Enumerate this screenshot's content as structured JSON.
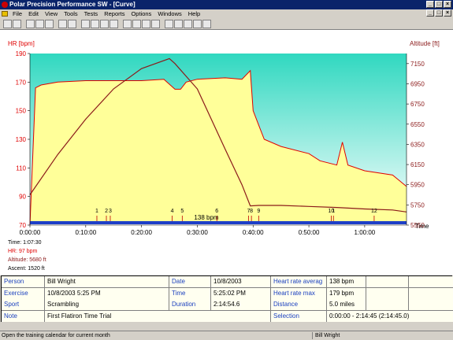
{
  "window": {
    "title": "Polar Precision Performance SW - [Curve]"
  },
  "menu": [
    "File",
    "Edit",
    "View",
    "Tools",
    "Tests",
    "Reports",
    "Options",
    "Windows",
    "Help"
  ],
  "chart": {
    "hr_axis_label": "HR [bpm]",
    "alt_axis_label": "Altitude [ft]",
    "time_label": "Time",
    "hr_ticks": [
      "190",
      "170",
      "150",
      "130",
      "110",
      "90",
      "70"
    ],
    "alt_ticks": [
      "7150",
      "6950",
      "6750",
      "6550",
      "6350",
      "6150",
      "5950",
      "5750",
      "5550"
    ],
    "time_ticks": [
      "0:00:00",
      "0:10:00",
      "0:20:00",
      "0:30:00",
      "0:40:00",
      "0:50:00",
      "1:00:00"
    ],
    "lap_labels": [
      "1",
      "2",
      "3",
      "4",
      "5",
      "6",
      "7",
      "8",
      "9",
      "10",
      "1",
      "12"
    ],
    "avg_label": "138 bpm",
    "cursor": {
      "time": "Time: 1:07:30",
      "hr": "HR: 97 bpm",
      "altitude": "Altitude: 5680 ft",
      "ascent": "Ascent: 1520 ft"
    },
    "colors": {
      "hr": "#e00000",
      "altitude": "#8b1a1a",
      "fill": "#ffff99",
      "bg_top": "#30d8c0",
      "bg_bottom": "#ffffff",
      "band": "#1e3fc8"
    }
  },
  "chart_data": {
    "type": "line",
    "x_unit": "h:mm:ss",
    "xlim": [
      "0:00:00",
      "1:07:30"
    ],
    "ylim_hr": [
      70,
      190
    ],
    "ylim_altitude": [
      5550,
      7250
    ],
    "series": [
      {
        "name": "HR",
        "x_min": [
          0,
          1,
          2,
          5,
          10,
          15,
          20,
          24,
          26,
          27,
          28,
          30,
          35,
          38,
          39.5,
          40,
          41,
          42,
          45,
          50,
          52,
          55,
          56,
          57,
          60,
          65,
          67.5
        ],
        "values": [
          0,
          166,
          168,
          170,
          171,
          171,
          171,
          172,
          165,
          165,
          170,
          172,
          173,
          172,
          178,
          150,
          140,
          130,
          125,
          120,
          115,
          112,
          128,
          112,
          108,
          105,
          97
        ]
      },
      {
        "name": "Altitude",
        "x_min": [
          0,
          5,
          10,
          15,
          20,
          25,
          26,
          30,
          35,
          38,
          39.5,
          41,
          45,
          50,
          55,
          60,
          65,
          67.5
        ],
        "values": [
          5850,
          6250,
          6600,
          6900,
          7100,
          7200,
          7150,
          6900,
          6300,
          5950,
          5740,
          5745,
          5745,
          5735,
          5725,
          5710,
          5700,
          5680
        ]
      }
    ],
    "average_hr": 138
  },
  "info": {
    "person_label": "Person",
    "person": "Bill Wright",
    "exercise_label": "Exercise",
    "exercise": "10/8/2003 5:25 PM",
    "sport_label": "Sport",
    "sport": "Scrambling",
    "note_label": "Note",
    "note": "First Flatiron Time Trial",
    "date_label": "Date",
    "date": "10/8/2003",
    "time_label": "Time",
    "time": "5:25:02 PM",
    "duration_label": "Duration",
    "duration": "2:14:54.6",
    "hravg_label": "Heart rate averag",
    "hravg": "138 bpm",
    "hrmax_label": "Heart rate max",
    "hrmax": "179 bpm",
    "distance_label": "Distance",
    "distance": "5.0 miles",
    "selection_label": "Selection",
    "selection": "0:00:00 - 2:14:45 (2:14:45.0)"
  },
  "status": {
    "left": "Open the training calendar for current month",
    "right": "Bill Wright"
  }
}
